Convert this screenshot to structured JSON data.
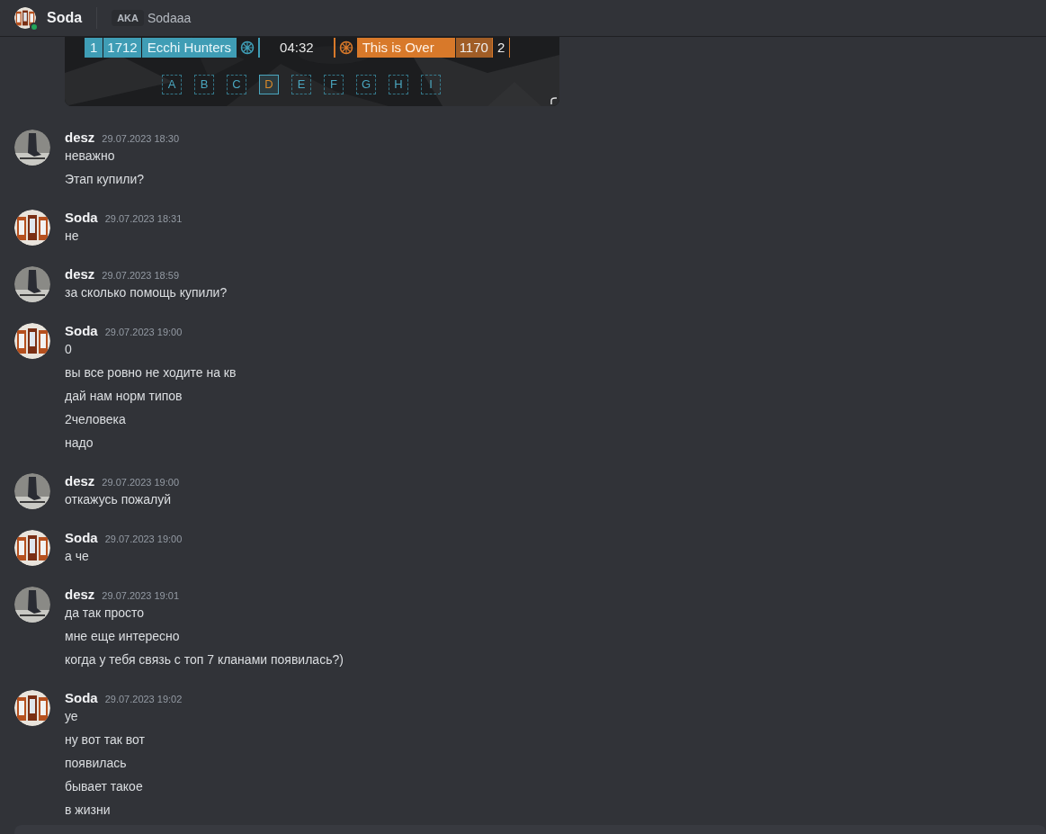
{
  "header": {
    "name": "Soda",
    "online": true,
    "aka_label": "AKA",
    "aka_name": "Sodaaa"
  },
  "embed": {
    "kind": "game-hud",
    "left_team": {
      "rank": "1",
      "score": "1712",
      "name": "Ecchi Hunters"
    },
    "timer": "04:32",
    "right_team": {
      "name": "This is Over",
      "score": "1170",
      "rank": "2"
    },
    "points": [
      {
        "label": "A",
        "selected": false
      },
      {
        "label": "B",
        "selected": false
      },
      {
        "label": "C",
        "selected": false
      },
      {
        "label": "D",
        "selected": true
      },
      {
        "label": "E",
        "selected": false
      },
      {
        "label": "F",
        "selected": false
      },
      {
        "label": "G",
        "selected": false
      },
      {
        "label": "H",
        "selected": false
      },
      {
        "label": "I",
        "selected": false
      }
    ]
  },
  "messages": [
    {
      "author": "desz",
      "kind": "desz",
      "time": "29.07.2023 18:30",
      "lines": [
        "неважно",
        "Этап купили?"
      ]
    },
    {
      "author": "Soda",
      "kind": "soda",
      "time": "29.07.2023 18:31",
      "lines": [
        "не"
      ]
    },
    {
      "author": "desz",
      "kind": "desz",
      "time": "29.07.2023 18:59",
      "lines": [
        "за сколько помощь купили?"
      ]
    },
    {
      "author": "Soda",
      "kind": "soda",
      "time": "29.07.2023 19:00",
      "lines": [
        "0",
        "вы все ровно не ходите на кв",
        "дай нам норм типов",
        "2человека",
        "надо"
      ]
    },
    {
      "author": "desz",
      "kind": "desz",
      "time": "29.07.2023 19:00",
      "lines": [
        "откажусь пожалуй"
      ]
    },
    {
      "author": "Soda",
      "kind": "soda",
      "time": "29.07.2023 19:00",
      "lines": [
        "а че"
      ]
    },
    {
      "author": "desz",
      "kind": "desz",
      "time": "29.07.2023 19:01",
      "lines": [
        "да так просто",
        "мне еще интересно",
        "когда у тебя связь с топ 7 кланами появилась?)"
      ]
    },
    {
      "author": "Soda",
      "kind": "soda",
      "time": "29.07.2023 19:02",
      "lines": [
        "уе",
        "ну вот так вот",
        "появилась",
        "бывает такое",
        "в жизни"
      ]
    }
  ]
}
